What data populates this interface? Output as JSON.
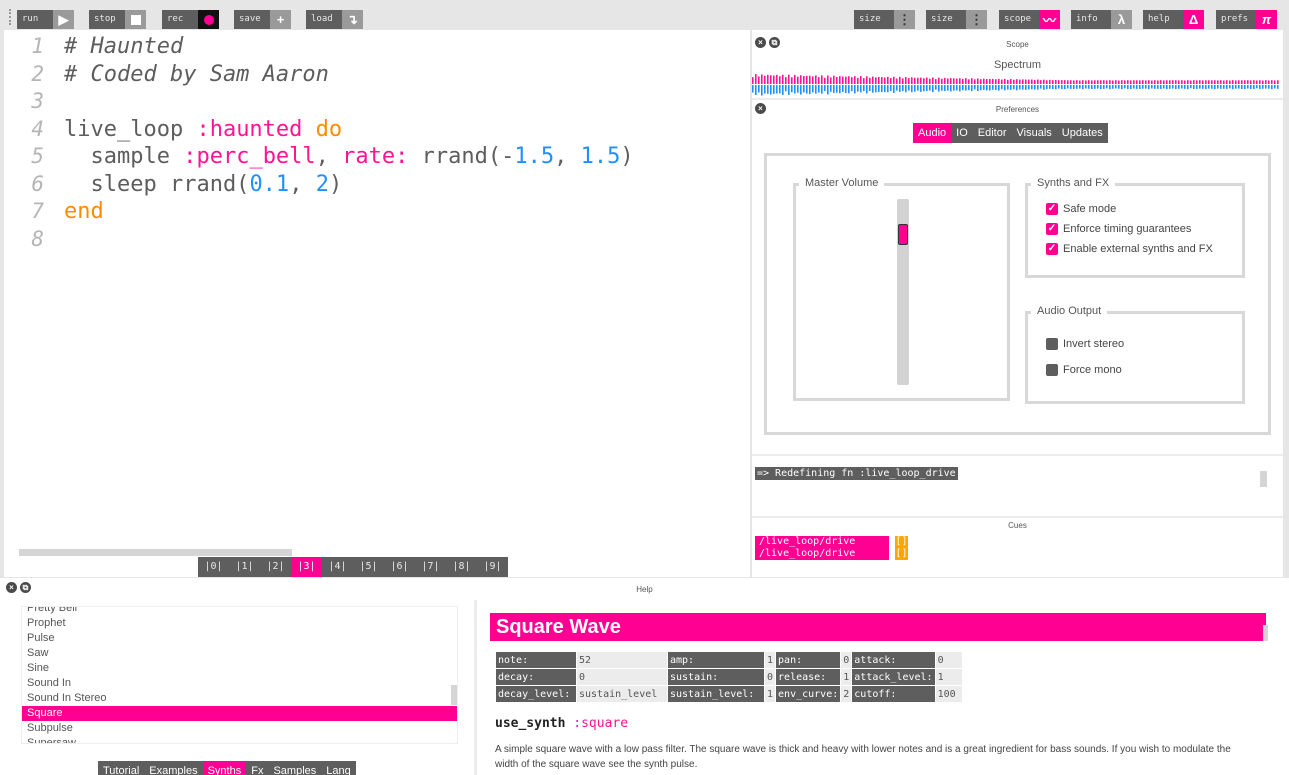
{
  "toolbar": {
    "left_buttons": [
      {
        "label": "run",
        "icon": "play-icon",
        "glyph": "▶"
      },
      {
        "label": "stop",
        "icon": "stop-icon",
        "glyph": "■"
      },
      {
        "label": "rec",
        "icon": "record-icon",
        "glyph": "●"
      },
      {
        "label": "save",
        "icon": "plus-icon",
        "glyph": "+"
      },
      {
        "label": "load",
        "icon": "load-arrow-icon",
        "glyph": "↴"
      }
    ],
    "right_buttons": [
      {
        "label": "size",
        "icon": "size-down-icon",
        "glyph": "⋮"
      },
      {
        "label": "size",
        "icon": "size-up-icon",
        "glyph": "⋮"
      },
      {
        "label": "scope",
        "icon": "scope-wave-icon",
        "glyph": "〰"
      },
      {
        "label": "info",
        "icon": "lambda-icon",
        "glyph": "λ"
      },
      {
        "label": "help",
        "icon": "delta-icon",
        "glyph": "Δ"
      },
      {
        "label": "prefs",
        "icon": "pi-icon",
        "glyph": "π"
      }
    ]
  },
  "editor": {
    "line_numbers": [
      "1",
      "2",
      "3",
      "4",
      "5",
      "6",
      "7",
      "8"
    ],
    "lines": [
      [
        {
          "t": "# Haunted",
          "c": "comment"
        }
      ],
      [
        {
          "t": "# Coded by Sam Aaron",
          "c": "comment"
        }
      ],
      [],
      [
        {
          "t": "live_loop ",
          "c": "tx"
        },
        {
          "t": ":haunted",
          "c": "sym"
        },
        {
          "t": " do",
          "c": "kw"
        }
      ],
      [
        {
          "t": "  sample ",
          "c": "tx"
        },
        {
          "t": ":perc_bell",
          "c": "sym"
        },
        {
          "t": ", ",
          "c": "tx"
        },
        {
          "t": "rate:",
          "c": "sym"
        },
        {
          "t": " rrand(-",
          "c": "tx"
        },
        {
          "t": "1.5",
          "c": "num"
        },
        {
          "t": ", ",
          "c": "tx"
        },
        {
          "t": "1.5",
          "c": "num"
        },
        {
          "t": ")",
          "c": "tx"
        }
      ],
      [
        {
          "t": "  sleep rrand(",
          "c": "tx"
        },
        {
          "t": "0.1",
          "c": "num"
        },
        {
          "t": ", ",
          "c": "tx"
        },
        {
          "t": "2",
          "c": "num"
        },
        {
          "t": ")",
          "c": "tx"
        }
      ],
      [
        {
          "t": "end",
          "c": "kw"
        }
      ],
      []
    ],
    "buffers": [
      "|0|",
      "|1|",
      "|2|",
      "|3|",
      "|4|",
      "|5|",
      "|6|",
      "|7|",
      "|8|",
      "|9|"
    ],
    "active_buffer": 3
  },
  "scope": {
    "title": "Scope",
    "spectrum_label": "Spectrum",
    "colors": {
      "left": "#ff1493",
      "right": "#1e90ff"
    }
  },
  "preferences": {
    "title": "Preferences",
    "tabs": [
      "Audio",
      "IO",
      "Editor",
      "Visuals",
      "Updates"
    ],
    "active_tab": "Audio",
    "master_volume": {
      "label": "Master Volume",
      "level": 0.85
    },
    "synths_fx": {
      "label": "Synths and FX",
      "options": [
        {
          "label": "Safe mode",
          "checked": true
        },
        {
          "label": "Enforce timing guarantees",
          "checked": true
        },
        {
          "label": "Enable external synths and FX",
          "checked": true
        }
      ]
    },
    "audio_output": {
      "label": "Audio Output",
      "options": [
        {
          "label": "Invert stereo",
          "checked": false
        },
        {
          "label": "Force mono",
          "checked": false
        }
      ]
    }
  },
  "log": {
    "line": "=> Redefining fn :live_loop_drive"
  },
  "cues": {
    "title": "Cues",
    "items": [
      {
        "path": "/live_loop/drive",
        "args": "[]"
      },
      {
        "path": "/live_loop/drive",
        "args": "[]"
      }
    ]
  },
  "help": {
    "title": "Help",
    "list": [
      "Pretty Bell",
      "Prophet",
      "Pulse",
      "Saw",
      "Sine",
      "Sound In",
      "Sound In Stereo",
      "Square",
      "Subpulse",
      "Supersaw"
    ],
    "selected": "Square",
    "tabs": [
      "Tutorial",
      "Examples",
      "Synths",
      "Fx",
      "Samples",
      "Lang"
    ],
    "active_tab": "Synths",
    "doc": {
      "title": "Square Wave",
      "args": [
        [
          "note:",
          "52",
          "amp:",
          "1",
          "pan:",
          "0",
          "attack:",
          "0"
        ],
        [
          "decay:",
          "0",
          "sustain:",
          "0",
          "release:",
          "1",
          "attack_level:",
          "1"
        ],
        [
          "decay_level:",
          "sustain_level",
          "sustain_level:",
          "1",
          "env_curve:",
          "2",
          "cutoff:",
          "100"
        ]
      ],
      "usage_fn": "use_synth",
      "usage_sym": ":square",
      "description": "A simple square wave with a low pass filter. The square wave is thick and heavy with lower notes and is a great ingredient for bass sounds. If you wish to modulate the width of the square wave see the synth pulse."
    }
  }
}
